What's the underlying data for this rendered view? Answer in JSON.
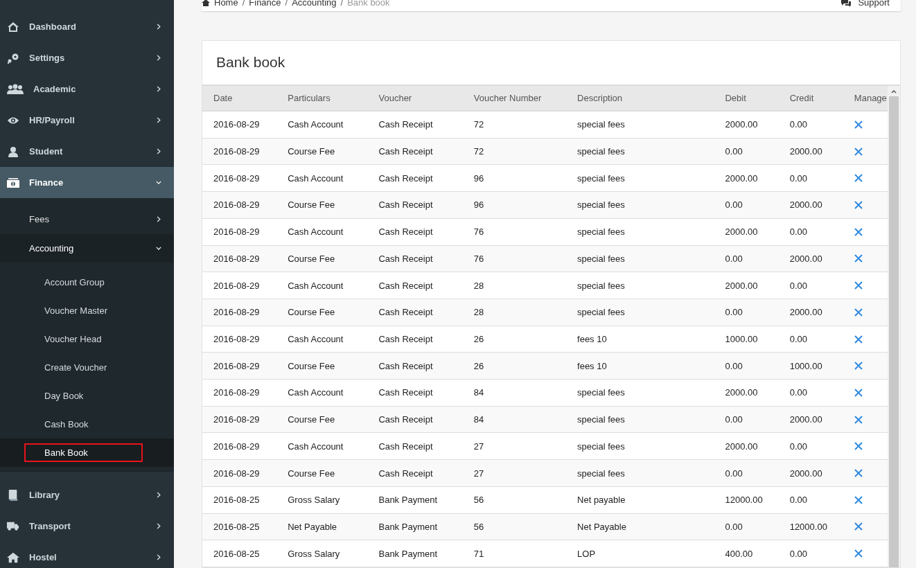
{
  "sidebar": {
    "items": [
      {
        "label": "Dashboard",
        "expanded": false,
        "selected": false
      },
      {
        "label": "Settings",
        "expanded": false,
        "selected": false
      },
      {
        "label": "Academic",
        "expanded": false,
        "selected": false
      },
      {
        "label": "HR/Payroll",
        "expanded": false,
        "selected": false
      },
      {
        "label": "Student",
        "expanded": false,
        "selected": false
      },
      {
        "label": "Finance",
        "expanded": true,
        "selected": true,
        "children": [
          {
            "label": "Fees",
            "expanded": false,
            "selected": false
          },
          {
            "label": "Accounting",
            "expanded": true,
            "selected": true,
            "children": [
              {
                "label": "Account Group",
                "selected": false
              },
              {
                "label": "Voucher Master",
                "selected": false
              },
              {
                "label": "Voucher Head",
                "selected": false
              },
              {
                "label": "Create Voucher",
                "selected": false
              },
              {
                "label": "Day Book",
                "selected": false
              },
              {
                "label": "Cash Book",
                "selected": false
              },
              {
                "label": "Bank Book",
                "selected": true
              }
            ]
          }
        ]
      },
      {
        "label": "Library",
        "expanded": false,
        "selected": false
      },
      {
        "label": "Transport",
        "expanded": false,
        "selected": false
      },
      {
        "label": "Hostel",
        "expanded": false,
        "selected": false
      }
    ]
  },
  "breadcrumb": [
    "Home",
    "Finance",
    "Accounting",
    "Bank book"
  ],
  "breadcrumb_separator": "/",
  "support": "Support",
  "card": {
    "title": "Bank book"
  },
  "table": {
    "columns": [
      "Date",
      "Particulars",
      "Voucher",
      "Voucher Number",
      "Description",
      "Debit",
      "Credit",
      "Manage"
    ],
    "rows": [
      [
        "2016-08-29",
        "Cash Account",
        "Cash Receipt",
        "72",
        "special fees",
        "2000.00",
        "0.00"
      ],
      [
        "2016-08-29",
        "Course Fee",
        "Cash Receipt",
        "72",
        "special fees",
        "0.00",
        "2000.00"
      ],
      [
        "2016-08-29",
        "Cash Account",
        "Cash Receipt",
        "96",
        "special fees",
        "2000.00",
        "0.00"
      ],
      [
        "2016-08-29",
        "Course Fee",
        "Cash Receipt",
        "96",
        "special fees",
        "0.00",
        "2000.00"
      ],
      [
        "2016-08-29",
        "Cash Account",
        "Cash Receipt",
        "76",
        "special fees",
        "2000.00",
        "0.00"
      ],
      [
        "2016-08-29",
        "Course Fee",
        "Cash Receipt",
        "76",
        "special fees",
        "0.00",
        "2000.00"
      ],
      [
        "2016-08-29",
        "Cash Account",
        "Cash Receipt",
        "28",
        "special fees",
        "2000.00",
        "0.00"
      ],
      [
        "2016-08-29",
        "Course Fee",
        "Cash Receipt",
        "28",
        "special fees",
        "0.00",
        "2000.00"
      ],
      [
        "2016-08-29",
        "Cash Account",
        "Cash Receipt",
        "26",
        "fees 10",
        "1000.00",
        "0.00"
      ],
      [
        "2016-08-29",
        "Course Fee",
        "Cash Receipt",
        "26",
        "fees 10",
        "0.00",
        "1000.00"
      ],
      [
        "2016-08-29",
        "Cash Account",
        "Cash Receipt",
        "84",
        "special fees",
        "2000.00",
        "0.00"
      ],
      [
        "2016-08-29",
        "Course Fee",
        "Cash Receipt",
        "84",
        "special fees",
        "0.00",
        "2000.00"
      ],
      [
        "2016-08-29",
        "Cash Account",
        "Cash Receipt",
        "27",
        "special fees",
        "2000.00",
        "0.00"
      ],
      [
        "2016-08-29",
        "Course Fee",
        "Cash Receipt",
        "27",
        "special fees",
        "0.00",
        "2000.00"
      ],
      [
        "2016-08-25",
        "Gross Salary",
        "Bank Payment",
        "56",
        "Net payable",
        "12000.00",
        "0.00"
      ],
      [
        "2016-08-25",
        "Net Payable",
        "Bank Payment",
        "56",
        "Net Payable",
        "0.00",
        "12000.00"
      ],
      [
        "2016-08-25",
        "Gross Salary",
        "Bank Payment",
        "71",
        "LOP",
        "400.00",
        "0.00"
      ]
    ]
  }
}
